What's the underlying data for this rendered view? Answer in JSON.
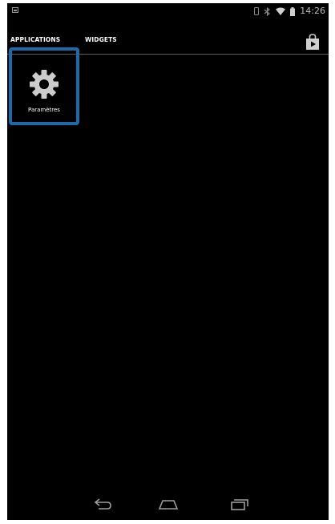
{
  "status_bar": {
    "time": "14:26",
    "icons": [
      "notification-icon",
      "vibrate-icon",
      "bluetooth-icon",
      "wifi-icon",
      "battery-icon"
    ]
  },
  "tabs": [
    {
      "label": "APPLICATIONS",
      "selected": true
    },
    {
      "label": "WIDGETS",
      "selected": false
    }
  ],
  "store_icon": "play-store-icon",
  "apps": [
    {
      "label": "Paramètres",
      "icon": "settings-gear-icon",
      "highlighted": true
    }
  ],
  "colors": {
    "background": "#000000",
    "highlight": "#1d6aa8",
    "text": "#ffffff",
    "icon": "#cccccc"
  },
  "nav_bar": {
    "buttons": [
      "back-icon",
      "home-icon",
      "recent-apps-icon"
    ]
  }
}
